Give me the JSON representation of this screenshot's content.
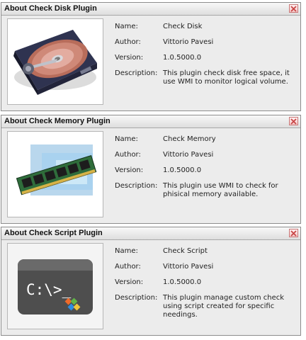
{
  "labels": {
    "name": "Name:",
    "author": "Author:",
    "version": "Version:",
    "description": "Description:"
  },
  "dialogs": [
    {
      "title": "About Check Disk Plugin",
      "icon": "hard-disk-image",
      "name": "Check Disk",
      "author": "Vittorio Pavesi",
      "version": "1.0.5000.0",
      "description_line1": "This plugin check disk free space, it",
      "description_line2": "use WMI to monitor logical volume.",
      "description_line3": ""
    },
    {
      "title": "About Check Memory Plugin",
      "icon": "memory-module-image",
      "name": "Check Memory",
      "author": "Vittorio Pavesi",
      "version": "1.0.5000.0",
      "description_line1": "This plugin use WMI to check for",
      "description_line2": "phisical memory available.",
      "description_line3": ""
    },
    {
      "title": "About Check Script Plugin",
      "icon": "command-prompt-image",
      "name": "Check Script",
      "author": "Vittorio Pavesi",
      "version": "1.0.5000.0",
      "description_line1": "This plugin manage custom check",
      "description_line2": "using script created for specific",
      "description_line3": "needings.",
      "prompt_text": "C:\\>_"
    }
  ],
  "colors": {
    "close_button_border": "#c97878",
    "close_x": "#c84747",
    "dialog_background": "#ececec"
  }
}
